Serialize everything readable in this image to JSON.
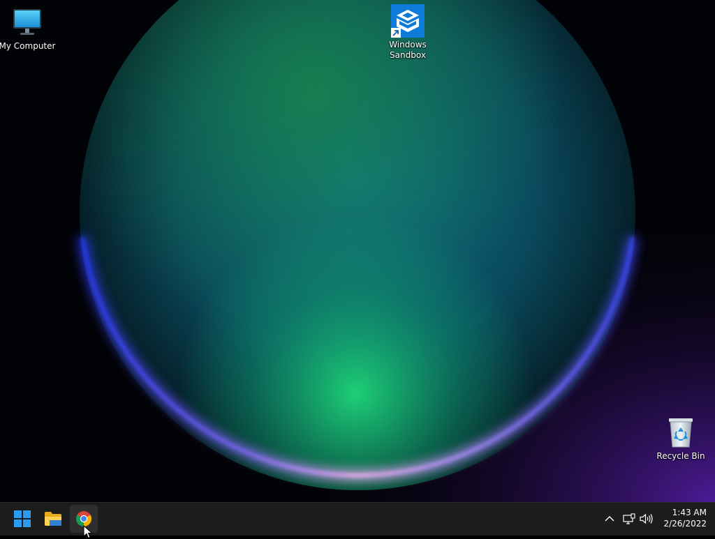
{
  "desktop": {
    "icons": [
      {
        "label": "My Computer",
        "icon": "monitor-icon"
      },
      {
        "label": "Windows\nSandbox",
        "icon": "sandbox-icon",
        "shortcut": true
      },
      {
        "label": "Recycle Bin",
        "icon": "recycle-bin-icon"
      }
    ]
  },
  "taskbar": {
    "apps": [
      {
        "name": "Start",
        "icon": "windows-logo-icon"
      },
      {
        "name": "File Explorer",
        "icon": "folder-icon"
      },
      {
        "name": "Google Chrome",
        "icon": "chrome-icon",
        "active": true
      }
    ],
    "tray": {
      "icons": [
        "chevron-up-icon",
        "network-icon",
        "volume-icon"
      ],
      "time": "1:43 AM",
      "date": "2/26/2022"
    }
  },
  "colors": {
    "accent": "#0078d4",
    "taskbar_bg": "#1c1c1c",
    "wallpaper_green": "#1fc26b",
    "wallpaper_teal": "#0a6f8c",
    "wallpaper_violet": "#7a2bd6"
  }
}
